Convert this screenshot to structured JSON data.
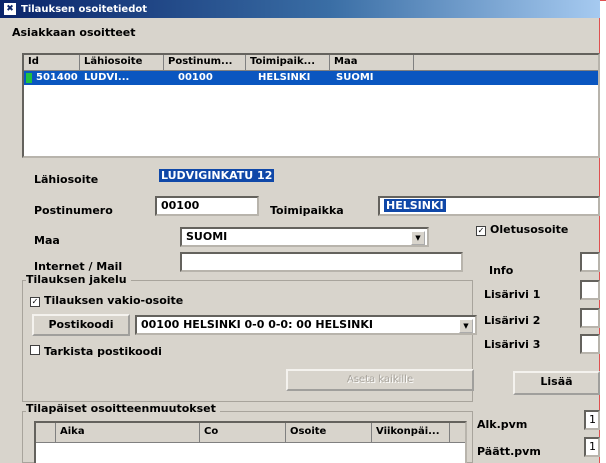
{
  "window": {
    "title": "Tilauksen osoitetiedot"
  },
  "addresses_section": {
    "title": "Asiakkaan osoitteet",
    "columns": [
      "Id",
      "Lähiosoite",
      "Postinum...",
      "Toimipaik...",
      "Maa"
    ],
    "rows": [
      {
        "id": "501400",
        "street": "LUDVI...",
        "postal": "00100",
        "city": "HELSINKI",
        "country": "SUOMI"
      }
    ]
  },
  "form": {
    "street_label": "Lähiosoite",
    "street_value": "LUDVIGINKATU 12",
    "postal_label": "Postinumero",
    "postal_value": "00100",
    "city_label": "Toimipaikka",
    "city_value": "HELSINKI",
    "country_label": "Maa",
    "country_value": "SUOMI",
    "default_address_label": "Oletusosoite",
    "internet_label": "Internet / Mail",
    "internet_value": "",
    "info_label": "Info",
    "extra1_label": "Lisärivi 1",
    "extra2_label": "Lisärivi 2",
    "extra3_label": "Lisärivi 3"
  },
  "delivery": {
    "title": "Tilauksen jakelu",
    "standard_address_label": "Tilauksen vakio-osoite",
    "postal_code_button": "Postikoodi",
    "postal_code_value": "00100 HELSINKI 0-0 0-0: 00 HELSINKI",
    "check_postal_label": "Tarkista postikoodi",
    "disabled_button": "Aseta kaikille"
  },
  "add_button": "Lisää",
  "temporary": {
    "title": "Tilapäiset osoitteenmuutokset",
    "columns": [
      "Aika",
      "Co",
      "Osoite",
      "Viikonpäi..."
    ],
    "start_label": "Alk.pvm",
    "start_value": "1",
    "end_label": "Päätt.pvm",
    "end_value": "1"
  }
}
